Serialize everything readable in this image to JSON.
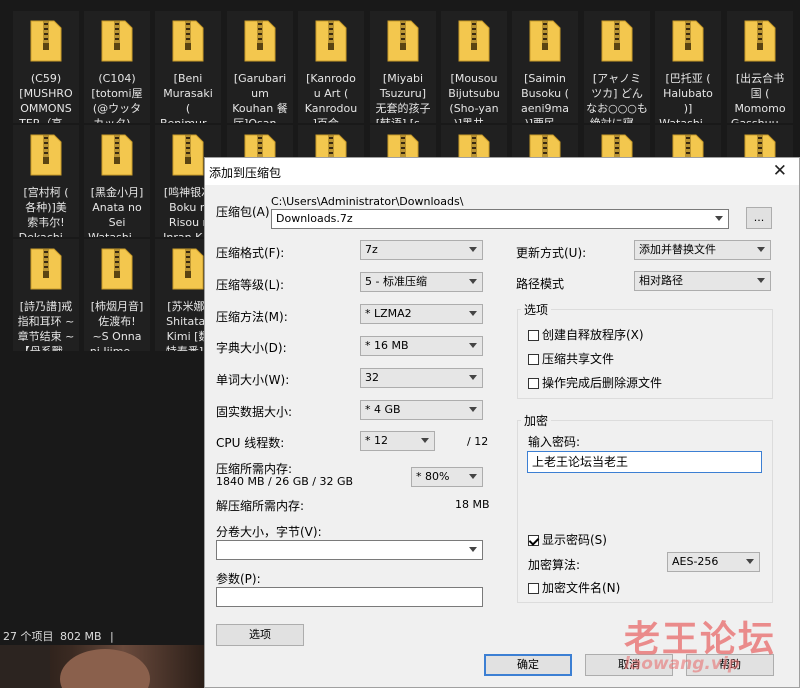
{
  "explorer": {
    "files": [
      {
        "name": "(C59)\n[MUSHRO\nOMMONS\nTER（高..."
      },
      {
        "name": "(C104)\n[totomi屋\n(@ウッタ\nカッタ)..."
      },
      {
        "name": "[Beni\nMurasaki\n(\nBenimur..."
      },
      {
        "name": "[Garubari\num\nKouhan 餐\n厅]Osan..."
      },
      {
        "name": "[Kanrodo\nu Art (\nKanrodou\n]百合..."
      },
      {
        "name": "[Miyabi\nTsuzuru]\n无套的孩子\n[韩语] [s..."
      },
      {
        "name": "[Mousou\nBijutsubu\n(Sho-yan\n)]黑井..."
      },
      {
        "name": "[Saimin\nBusoku (\naeni9ma\n)]要民..."
      },
      {
        "name": "[アャノミ\nツカ] どん\nなお○○○も\n絶対に寝..."
      },
      {
        "name": "[巴托亚 (\nHalubato\n)]\nWatashi ..."
      },
      {
        "name": "[出云合书\n国 (\nMomomo\nGasshuu..."
      },
      {
        "name": "[宫村柯 (\n各种)]美\n索韦尔!\nDekachi..."
      },
      {
        "name": "[黑金小月]\nAnata no\nSei\nWatashi ..."
      },
      {
        "name": "[鸣神银次\nBoku n\nRisou r\nInran K..."
      },
      {
        "name": ""
      },
      {
        "name": ""
      },
      {
        "name": ""
      },
      {
        "name": ""
      },
      {
        "name": ""
      },
      {
        "name": ""
      },
      {
        "name": ""
      },
      {
        "name": ""
      },
      {
        "name": "[詩乃譜]戒\n指和耳环 ~\n章节结束 ~\n【母系戰..."
      },
      {
        "name": "[柿烟月音]\n佐渡布!\n~S Onna\nni Ijime ..."
      },
      {
        "name": "[苏米娜]\nShitatar\nKimi [数\n特寿番].."
      }
    ]
  },
  "status": {
    "item_count": "27 个项目",
    "size": "802 MB",
    "separator": "|"
  },
  "dialog": {
    "title": "添加到压缩包",
    "archive_label": "压缩包(A)",
    "archive_path": "C:\\Users\\Administrator\\Downloads\\",
    "archive_name": "Downloads.7z",
    "browse_label": "...",
    "format_label": "压缩格式(F):",
    "format_value": "7z",
    "level_label": "压缩等级(L):",
    "level_value": "5 - 标准压缩",
    "method_label": "压缩方法(M):",
    "method_value": "*  LZMA2",
    "dict_label": "字典大小(D):",
    "dict_value": "*  16 MB",
    "word_label": "单词大小(W):",
    "word_value": "32",
    "solid_label": "固实数据大小:",
    "solid_value": "*  4 GB",
    "cpu_label": "CPU 线程数:",
    "cpu_value": "*  12",
    "cpu_total": "/ 12",
    "mem_label": "压缩所需内存:",
    "mem_value": "1840 MB / 26 GB / 32 GB",
    "mem_percent": "*  80%",
    "decomp_label": "解压缩所需内存:",
    "decomp_value": "18 MB",
    "split_label": "分卷大小，字节(V):",
    "split_value": "",
    "params_label": "参数(P):",
    "params_value": "",
    "options_button": "选项",
    "update_label": "更新方式(U):",
    "update_value": "添加并替换文件",
    "path_label": "路径模式",
    "path_value": "相对路径",
    "options_group": "选项",
    "opt_sfx": "创建自释放程序(X)",
    "opt_shared": "压缩共享文件",
    "opt_delete": "操作完成后删除源文件",
    "encrypt_group": "加密",
    "password_label": "输入密码:",
    "password_value": "上老王论坛当老王",
    "show_password": "显示密码(S)",
    "enc_method_label": "加密算法:",
    "enc_method_value": "AES-256",
    "encrypt_names": "加密文件名(N)",
    "ok": "确定",
    "cancel": "取消",
    "help": "帮助"
  },
  "watermark": {
    "text": "老王论坛",
    "url": "laowang.vip"
  },
  "colors": {
    "explorer_bg": "#191919",
    "dialog_bg": "#f0f0f0",
    "accent": "#3c7fd3",
    "watermark": "#e96a6a",
    "folder_yellow": "#f3c74e"
  },
  "icons": [
    "zip-folder-icon",
    "close-icon",
    "chevron-down-icon",
    "checkbox-icon"
  ]
}
